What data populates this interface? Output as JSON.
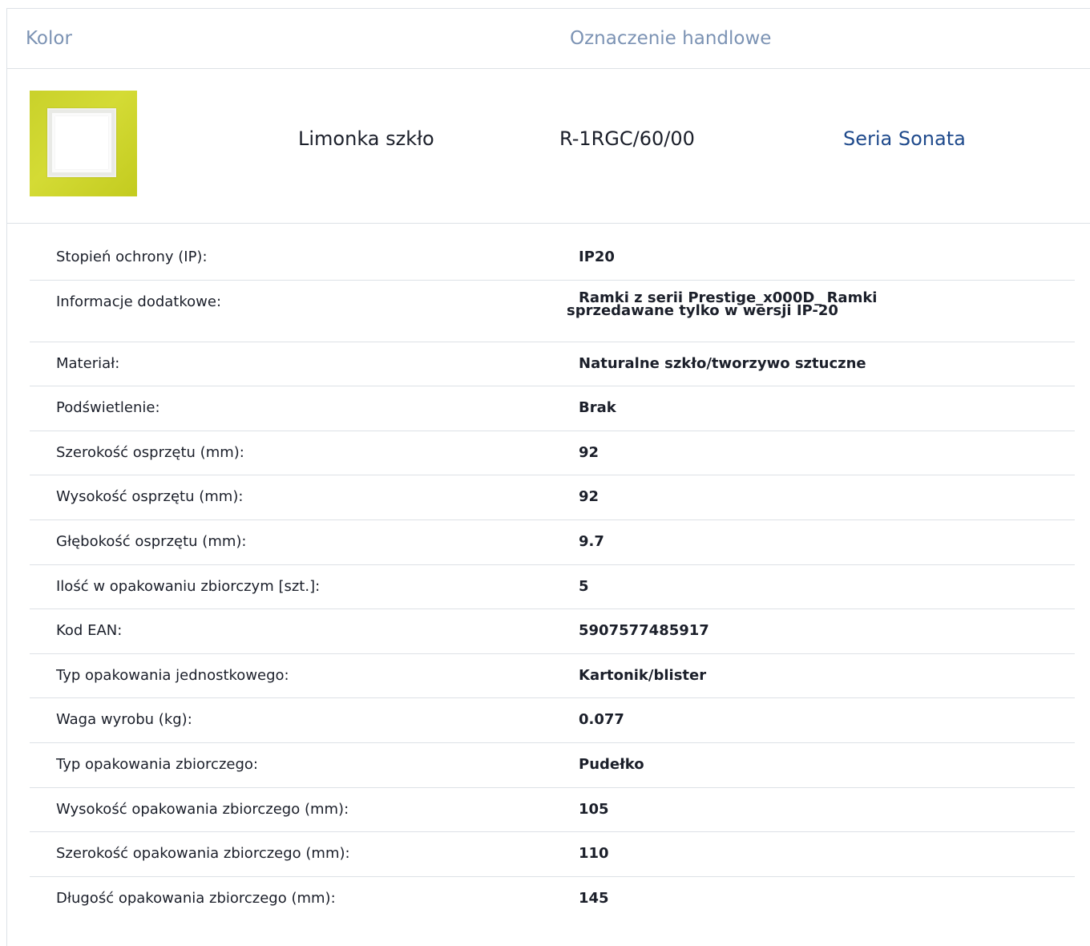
{
  "headers": {
    "color": "Kolor",
    "trade_designation": "Oznaczenie handlowe"
  },
  "product": {
    "swatch_icon": "frame-swatch-icon",
    "color_name": "Limonka szkło",
    "code": "R-1RGC/60/00",
    "series_link": "Seria Sonata"
  },
  "specs": [
    {
      "label": "Stopień ochrony (IP):",
      "value": "IP20"
    },
    {
      "label": "Informacje dodatkowe:",
      "value": "Ramki z serii Prestige_x000D_ Ramki sprzedawane tylko w wersji IP-20"
    },
    {
      "label": "Materiał:",
      "value": "Naturalne szkło/tworzywo sztuczne"
    },
    {
      "label": "Podświetlenie:",
      "value": "Brak"
    },
    {
      "label": "Szerokość osprzętu (mm):",
      "value": "92"
    },
    {
      "label": "Wysokość osprzętu (mm):",
      "value": "92"
    },
    {
      "label": "Głębokość osprzętu (mm):",
      "value": "9.7"
    },
    {
      "label": "Ilość w opakowaniu zbiorczym [szt.]:",
      "value": "5"
    },
    {
      "label": "Kod EAN:",
      "value": "5907577485917"
    },
    {
      "label": "Typ opakowania jednostkowego:",
      "value": "Kartonik/blister"
    },
    {
      "label": "Waga wyrobu (kg):",
      "value": "0.077"
    },
    {
      "label": "Typ opakowania zbiorczego:",
      "value": "Pudełko"
    },
    {
      "label": "Wysokość opakowania zbiorczego (mm):",
      "value": "105"
    },
    {
      "label": "Szerokość opakowania zbiorczego (mm):",
      "value": "110"
    },
    {
      "label": "Długość opakowania zbiorczego (mm):",
      "value": "145"
    }
  ],
  "colors": {
    "header_text": "#7c93b4",
    "link": "#1f4a8c",
    "divider": "#dde1e6",
    "swatch": "#c9d12a"
  }
}
